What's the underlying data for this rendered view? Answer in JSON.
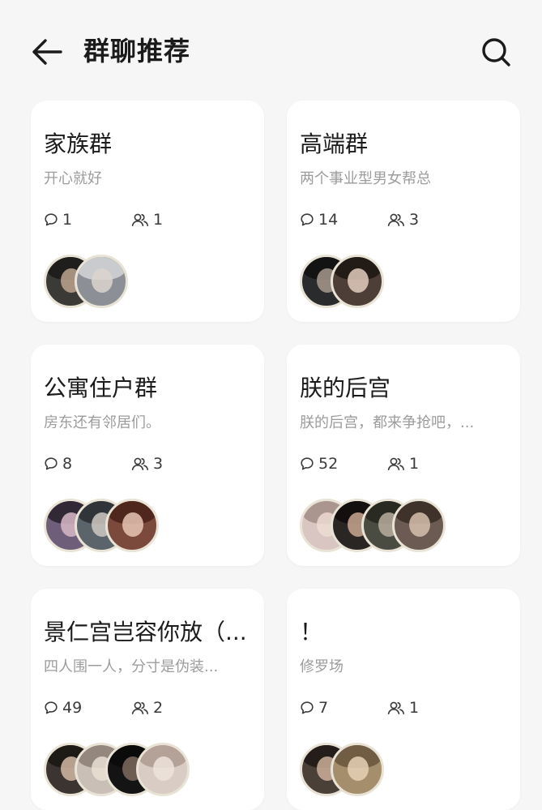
{
  "header": {
    "title": "群聊推荐",
    "back_icon": "arrow-left-icon",
    "search_icon": "search-icon"
  },
  "colors": {
    "background": "#f6f6f6",
    "card": "#ffffff",
    "text_primary": "#1b1b1b",
    "text_secondary": "#9c9c9c"
  },
  "groups": [
    {
      "name": "家族群",
      "desc": "开心就好",
      "comments": "1",
      "members": "1",
      "avatars": [
        {
          "bg": "#3b3a36",
          "hair": "#1e1c1a",
          "face": "#bca58e"
        },
        {
          "bg": "#8c8f96",
          "hair": "#cfd1d4",
          "face": "#dcd5cf"
        }
      ]
    },
    {
      "name": "高端群",
      "desc": "两个事业型男女帮总",
      "comments": "14",
      "members": "3",
      "avatars": [
        {
          "bg": "#2a2b2d",
          "hair": "#111111",
          "face": "#a89a8e"
        },
        {
          "bg": "#4d3f37",
          "hair": "#1f1713",
          "face": "#e3cdbd"
        }
      ]
    },
    {
      "name": "公寓住户群",
      "desc": "房东还有邻居们。",
      "comments": "8",
      "members": "3",
      "avatars": [
        {
          "bg": "#6e5e7a",
          "hair": "#2b2330",
          "face": "#d8b9c6"
        },
        {
          "bg": "#5b636b",
          "hair": "#2c3034",
          "face": "#cfc8c2"
        },
        {
          "bg": "#7b4a3c",
          "hair": "#4a2418",
          "face": "#e7c6b5"
        }
      ]
    },
    {
      "name": "朕的后宫",
      "desc": "朕的后宫，都来争抢吧，...",
      "comments": "52",
      "members": "1",
      "avatars": [
        {
          "bg": "#d9c6c3",
          "hair": "#a58f8a",
          "face": "#ecdcd4"
        },
        {
          "bg": "#2a2623",
          "hair": "#0f0d0c",
          "face": "#c9a88f"
        },
        {
          "bg": "#4a4c42",
          "hair": "#26281f",
          "face": "#b8ae9d"
        },
        {
          "bg": "#6b5b52",
          "hair": "#3a2d27",
          "face": "#d6c0ae"
        }
      ]
    },
    {
      "name": "景仁宫岂容你放（...",
      "desc": "四人围一人，分寸是伪装...",
      "comments": "49",
      "members": "2",
      "avatars": [
        {
          "bg": "#3b3430",
          "hair": "#1c1714",
          "face": "#d2b8a3"
        },
        {
          "bg": "#c9bfb6",
          "hair": "#8e8178",
          "face": "#eadfd4"
        },
        {
          "bg": "#141414",
          "hair": "#0a0a0a",
          "face": "#7d6a5e"
        },
        {
          "bg": "#d8ccc4",
          "hair": "#b09c92",
          "face": "#efe3da"
        }
      ]
    },
    {
      "name": "！",
      "desc": "修罗场",
      "comments": "7",
      "members": "1",
      "avatars": [
        {
          "bg": "#4b4038",
          "hair": "#201a16",
          "face": "#cdb09a"
        },
        {
          "bg": "#a58e6c",
          "hair": "#6b5640",
          "face": "#e6d1b6"
        }
      ]
    }
  ]
}
